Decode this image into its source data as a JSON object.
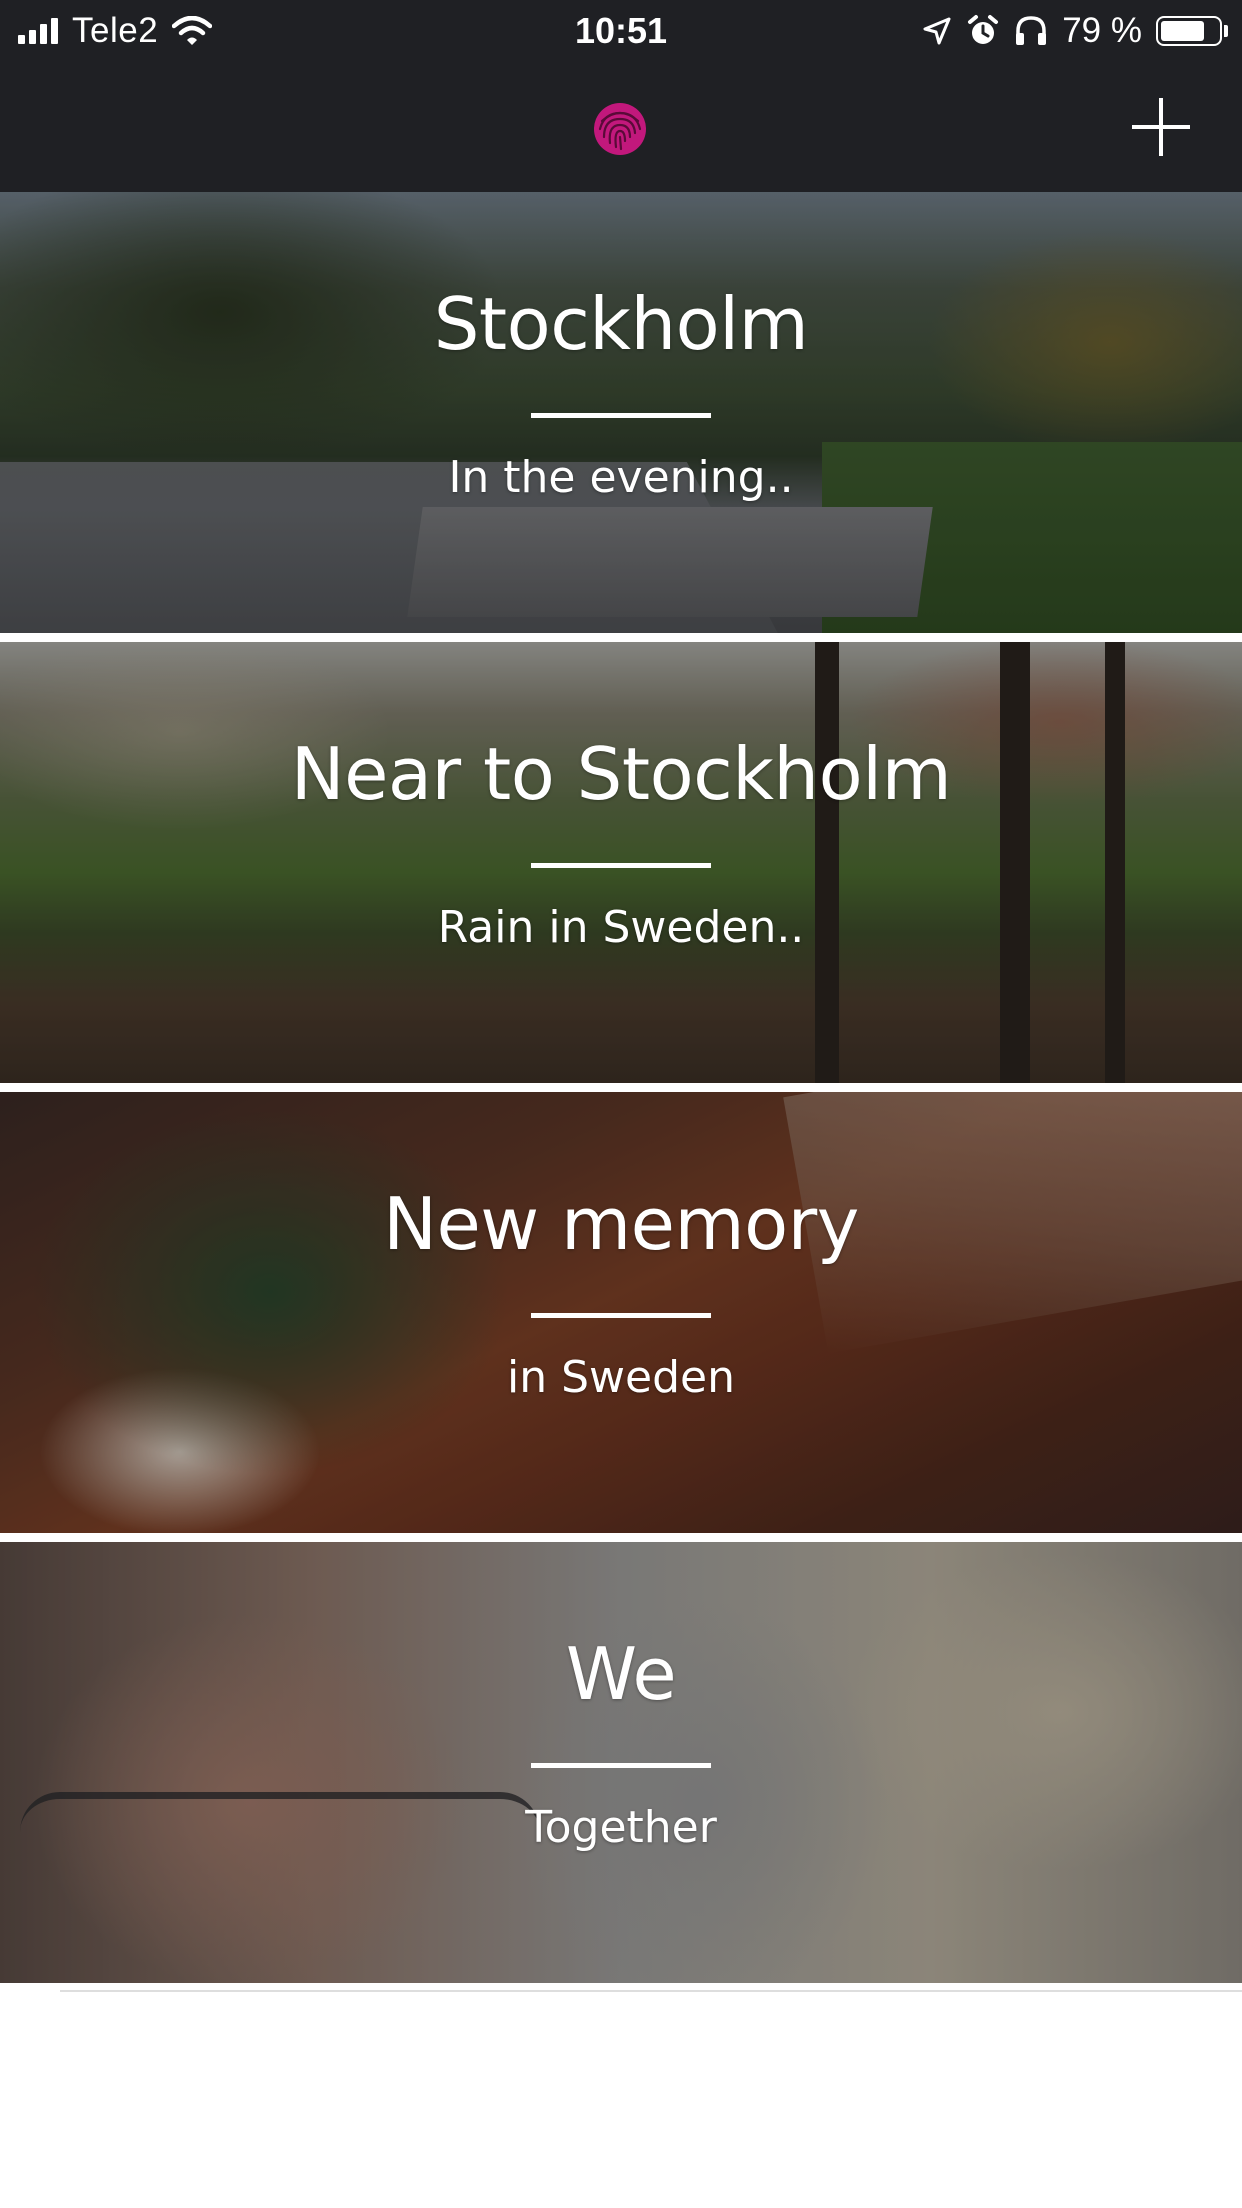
{
  "status_bar": {
    "carrier": "Tele2",
    "time": "10:51",
    "battery_percent": "79 %",
    "battery_level": 0.79,
    "icons": [
      "signal-icon",
      "wifi-icon",
      "location-arrow-icon",
      "alarm-icon",
      "headphones-icon",
      "battery-icon"
    ]
  },
  "nav_bar": {
    "logo_icon": "fingerprint-icon",
    "logo_color": "#c2187c",
    "add_icon": "plus-icon"
  },
  "memories": [
    {
      "title": "Stockholm",
      "subtitle": "In the evening.."
    },
    {
      "title": "Near to Stockholm",
      "subtitle": "Rain in Sweden.."
    },
    {
      "title": "New memory",
      "subtitle": "in Sweden"
    },
    {
      "title": "We",
      "subtitle": "Together"
    }
  ],
  "colors": {
    "bar_background": "#1f2024",
    "text": "#ffffff"
  }
}
